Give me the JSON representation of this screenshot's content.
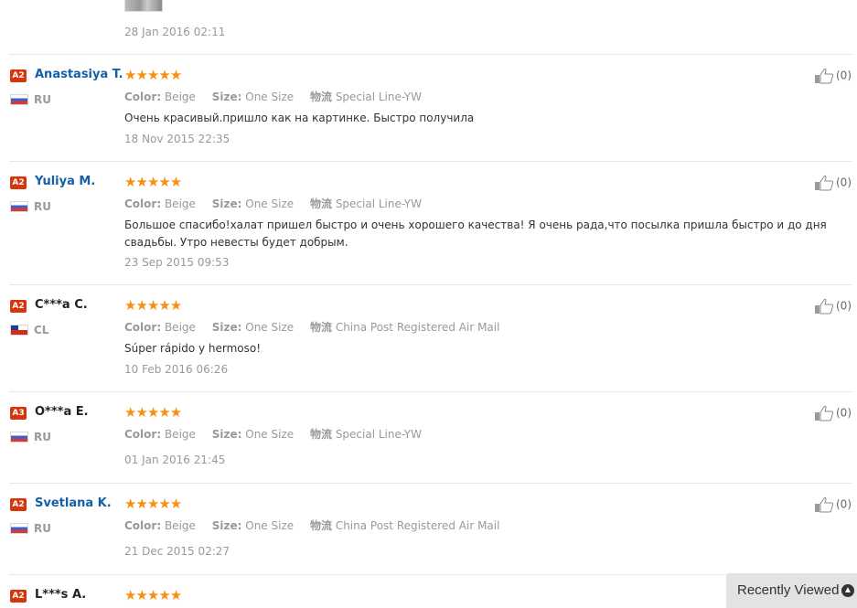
{
  "top_item": {
    "date": "28 Jan 2016 02:11"
  },
  "labels": {
    "color_key": "Color:",
    "size_key": "Size:",
    "shipping_key": "物流"
  },
  "reviews": [
    {
      "level": "A2",
      "name": "Anastasiya T.",
      "country": "RU",
      "stars": "★★★★★",
      "color": "Beige",
      "size": "One Size",
      "shipping": "Special Line-YW",
      "text": "Очень красивый.пришло как на картинке. Быстро получила",
      "date": "18 Nov 2015 22:35",
      "helpful": "(0)"
    },
    {
      "level": "A2",
      "name": "Yuliya M.",
      "country": "RU",
      "stars": "★★★★★",
      "color": "Beige",
      "size": "One Size",
      "shipping": "Special Line-YW",
      "text": "Большое спасибо!халат пришел быстро и очень хорошего качества! Я очень рада,что посылка пришла быстро и до дня свадьбы. Утро невесты будет добрым.",
      "date": "23 Sep 2015 09:53",
      "helpful": "(0)"
    },
    {
      "level": "A2",
      "name": "C***a C.",
      "country": "CL",
      "stars": "★★★★★",
      "color": "Beige",
      "size": "One Size",
      "shipping": "China Post Registered Air Mail",
      "text": "Súper rápido y hermoso!",
      "date": "10 Feb 2016 06:26",
      "helpful": "(0)"
    },
    {
      "level": "A3",
      "name": "O***a E.",
      "country": "RU",
      "stars": "★★★★★",
      "color": "Beige",
      "size": "One Size",
      "shipping": "Special Line-YW",
      "text": "",
      "date": "01 Jan 2016 21:45",
      "helpful": "(0)"
    },
    {
      "level": "A2",
      "name": "Svetlana K.",
      "country": "RU",
      "stars": "★★★★★",
      "color": "Beige",
      "size": "One Size",
      "shipping": "China Post Registered Air Mail",
      "text": "",
      "date": "21 Dec 2015 02:27",
      "helpful": "(0)"
    },
    {
      "level": "A2",
      "name": "L***s A.",
      "stars": "★★★★★"
    }
  ],
  "recently_viewed": {
    "label": "Recently Viewed",
    "icon": "chevron-up-icon"
  }
}
